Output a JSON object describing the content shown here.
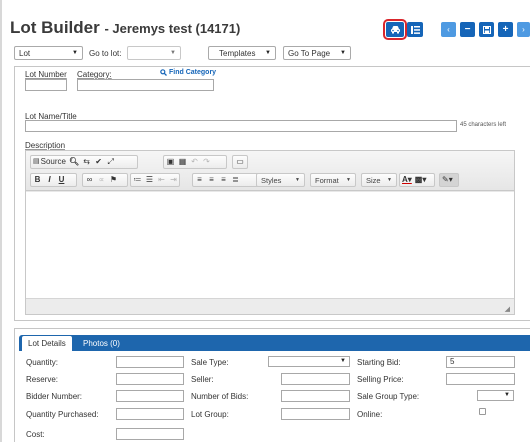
{
  "header": {
    "title": "Lot Builder",
    "subtitle": "- Jeremys test (14171)"
  },
  "toolbar": {
    "lot_select": "Lot",
    "goto_label": "Go to lot:",
    "goto_select": "",
    "templates_select": "Templates",
    "goto_page_select": "Go To Page",
    "icons": {
      "car": "car-icon",
      "list": "list-icon",
      "prev": "chevron-left-icon",
      "minus": "minus-icon",
      "save": "save-icon",
      "plus": "plus-icon",
      "next": "chevron-right-icon"
    }
  },
  "form": {
    "lot_number_label": "Lot Number",
    "category_label": "Category:",
    "find_category_label": "Find Category",
    "lot_name_label": "Lot Name/Title",
    "chars_left": "45 characters left",
    "description_label": "Description"
  },
  "editor": {
    "source_label": "Source",
    "styles_label": "Styles",
    "format_label": "Format",
    "size_label": "Size"
  },
  "details": {
    "tabs": [
      {
        "label": "Lot Details"
      },
      {
        "label": "Photos (0)"
      }
    ],
    "col1": {
      "quantity": "Quantity:",
      "reserve": "Reserve:",
      "bidder_number": "Bidder Number:",
      "quantity_purchased": "Quantity Purchased:",
      "cost": "Cost:"
    },
    "col2": {
      "sale_type": "Sale Type:",
      "seller": "Seller:",
      "number_of_bids": "Number of Bids:",
      "lot_group": "Lot Group:"
    },
    "col3": {
      "starting_bid": "Starting Bid:",
      "starting_bid_value": "5",
      "selling_price": "Selling Price:",
      "sale_group_type": "Sale Group Type:",
      "online": "Online:"
    }
  },
  "colors": {
    "accent_dark": "#1565b8",
    "accent_light": "#4e9ae2",
    "highlight_outline": "#d9262c",
    "tab_bar": "#1e66ad"
  }
}
